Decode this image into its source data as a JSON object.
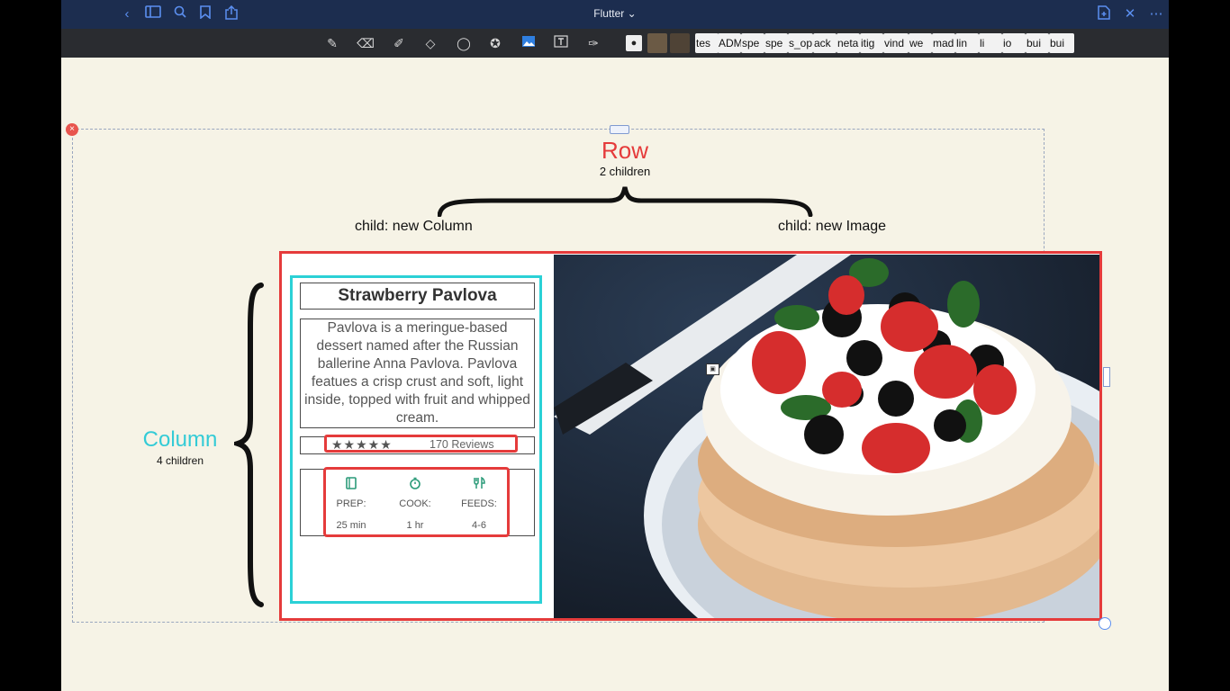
{
  "window": {
    "title": "Flutter ⌄"
  },
  "titlebar": {
    "icons": [
      "back-icon",
      "sidebar-icon",
      "search-icon",
      "bookmark-icon",
      "share-icon",
      "new-page-icon",
      "close-icon",
      "more-icon"
    ]
  },
  "toolbar": {
    "tools": [
      "pen-tool",
      "eraser-tool",
      "highlighter-tool",
      "shapes-tool",
      "lasso-tool",
      "favorites-tool",
      "image-tool",
      "text-tool",
      "laser-pointer-tool"
    ],
    "chips": [
      "tes",
      "ADM",
      "spe",
      "spe",
      "s_op",
      "ack",
      "neta",
      "itig",
      "vind",
      "we",
      "mad",
      "lin",
      "li",
      "io",
      "bui",
      "bui"
    ]
  },
  "diagram": {
    "row_label": "Row",
    "row_children": "2 children",
    "child_column": "child: new Column",
    "child_image": "child: new Image",
    "column_label": "Column",
    "column_children": "4 children"
  },
  "card": {
    "title": "Strawberry Pavlova",
    "description": "Pavlova is a meringue-based dessert named after the Russian ballerine Anna Pavlova. Pavlova featues a crisp crust and soft, light inside, topped with fruit and whipped cream.",
    "rating_stars": 5,
    "stars_text": "★★★★★",
    "reviews": "170 Reviews",
    "info": [
      {
        "icon": "book-icon",
        "label": "PREP:",
        "value": "25 min"
      },
      {
        "icon": "timer-icon",
        "label": "COOK:",
        "value": "1 hr"
      },
      {
        "icon": "utensils-icon",
        "label": "FEEDS:",
        "value": "4-6"
      }
    ]
  },
  "colors": {
    "row_accent": "#e53b3b",
    "column_accent": "#2bd1d6",
    "titlebar": "#1c2d4f",
    "toolbar": "#2a2c30",
    "canvas": "#f6f3e6"
  }
}
